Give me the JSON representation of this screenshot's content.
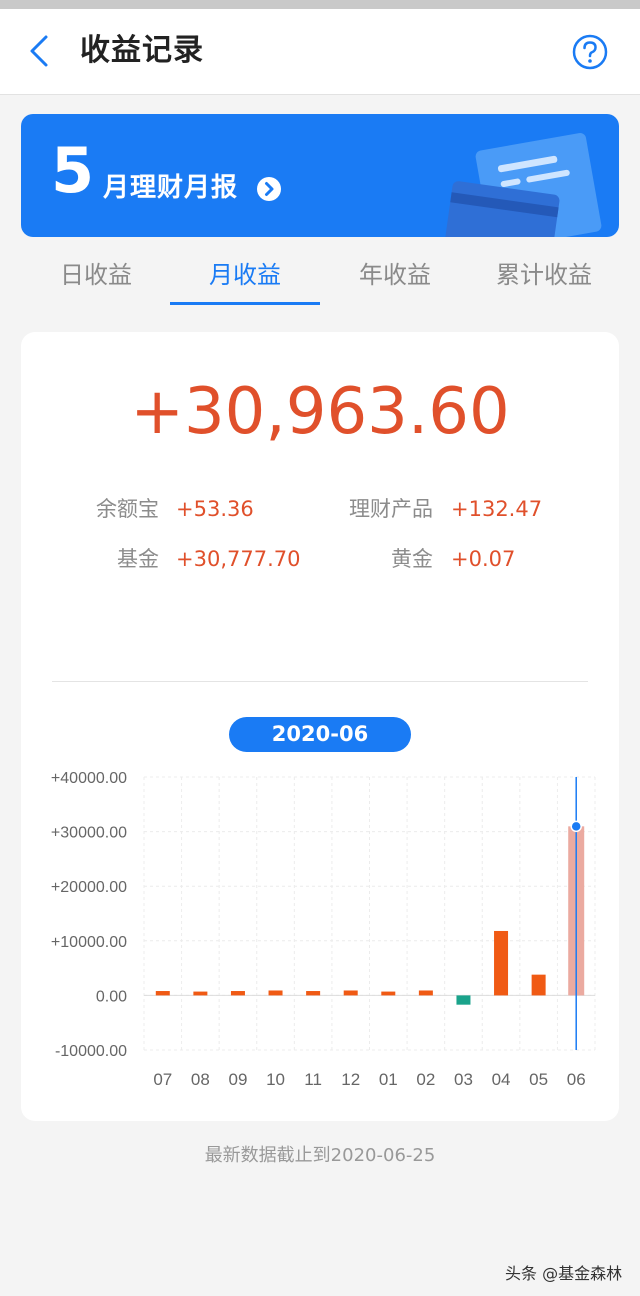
{
  "nav": {
    "title": "收益记录"
  },
  "banner": {
    "month": "5",
    "title": "月理财月报"
  },
  "tabs": [
    {
      "label": "日收益",
      "active": false
    },
    {
      "label": "月收益",
      "active": true
    },
    {
      "label": "年收益",
      "active": false
    },
    {
      "label": "累计收益",
      "active": false
    }
  ],
  "summary": {
    "total": "+30,963.60",
    "breakdown": [
      {
        "label": "余额宝",
        "value": "+53.36"
      },
      {
        "label": "理财产品",
        "value": "+132.47"
      },
      {
        "label": "基金",
        "value": "+30,777.70"
      },
      {
        "label": "黄金",
        "value": "+0.07"
      }
    ]
  },
  "period": "2020-06",
  "chart_data": {
    "type": "bar",
    "categories": [
      "07",
      "08",
      "09",
      "10",
      "11",
      "12",
      "01",
      "02",
      "03",
      "04",
      "05",
      "06"
    ],
    "values": [
      800,
      700,
      800,
      900,
      800,
      900,
      700,
      900,
      -1700,
      11800,
      3800,
      30963.6
    ],
    "selected_index": 11,
    "ylim": [
      -10000,
      40000
    ],
    "yticks": [
      "+40000.00",
      "+30000.00",
      "+20000.00",
      "+10000.00",
      "0.00",
      "-10000.00"
    ],
    "ytick_values": [
      40000,
      30000,
      20000,
      10000,
      0,
      -10000
    ],
    "colors": {
      "positive": "#f05a14",
      "negative": "#1aa38b",
      "selected": "#ebaaa0",
      "cursor": "#1a7bf4"
    },
    "grid": true
  },
  "footnote": "最新数据截止到2020-06-25",
  "watermark": "头条 @基金森林"
}
